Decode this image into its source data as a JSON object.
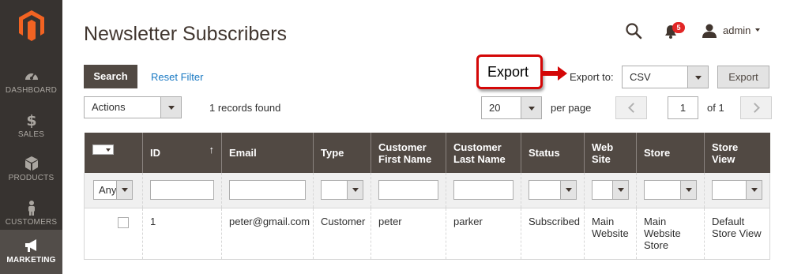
{
  "sidebar": {
    "logo": "magento-logo",
    "items": [
      {
        "label": "DASHBOARD",
        "icon": "speedometer-icon"
      },
      {
        "label": "SALES",
        "icon": "dollar-icon"
      },
      {
        "label": "PRODUCTS",
        "icon": "cube-icon"
      },
      {
        "label": "CUSTOMERS",
        "icon": "person-icon"
      },
      {
        "label": "MARKETING",
        "icon": "megaphone-icon",
        "active": true
      }
    ]
  },
  "header": {
    "title": "Newsletter Subscribers",
    "notification_count": "5",
    "user_name": "admin"
  },
  "toolbar": {
    "search_label": "Search",
    "reset_filter_label": "Reset Filter",
    "callout_label": "Export",
    "export_to_label": "Export to:",
    "export_format": "CSV",
    "export_button_label": "Export",
    "actions_label": "Actions",
    "records_found": "1 records found",
    "per_page_value": "20",
    "per_page_label": "per page",
    "current_page": "1",
    "total_pages_label": "of 1"
  },
  "grid": {
    "columns": [
      "ID",
      "Email",
      "Type",
      "Customer First Name",
      "Customer Last Name",
      "Status",
      "Web Site",
      "Store",
      "Store View"
    ],
    "headers": {
      "id": "ID",
      "email": "Email",
      "type": "Type",
      "first_name_1": "Customer",
      "first_name_2": "First Name",
      "last_name_1": "Customer",
      "last_name_2": "Last Name",
      "status": "Status",
      "website_1": "Web",
      "website_2": "Site",
      "store": "Store",
      "store_view": "Store View"
    },
    "filter_any": "Any",
    "rows": [
      {
        "id": "1",
        "email": "peter@gmail.com",
        "type": "Customer",
        "first_name": "peter",
        "last_name": "parker",
        "status": "Subscribed",
        "website_1": "Main",
        "website_2": "Website",
        "store_1": "Main",
        "store_2": "Website",
        "store_3": "Store",
        "store_view_1": "Default",
        "store_view_2": "Store View"
      }
    ]
  },
  "colors": {
    "sidebar_bg": "#373330",
    "sidebar_active": "#524d49",
    "header_bg": "#514943",
    "link": "#1979c3",
    "callout_border": "#d40707",
    "badge": "#e22626"
  }
}
